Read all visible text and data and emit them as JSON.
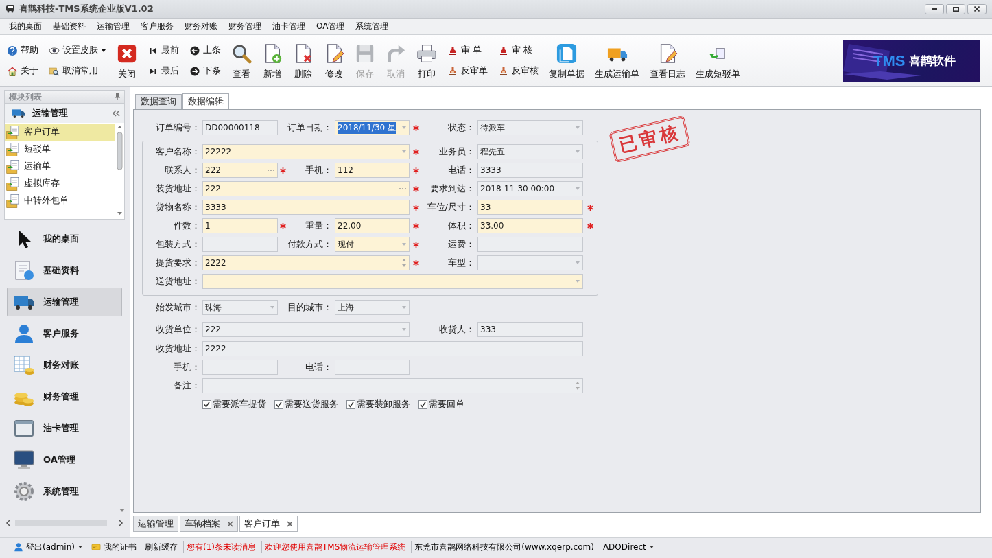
{
  "window": {
    "title": "喜鹊科技-TMS系统企业版V1.02"
  },
  "menu": [
    "我的桌面",
    "基础资料",
    "运输管理",
    "客户服务",
    "财务对账",
    "财务管理",
    "油卡管理",
    "OA管理",
    "系统管理"
  ],
  "toolbar": [
    {
      "kind": "stack",
      "buttons": [
        {
          "label": "帮助",
          "dropdown": false,
          "disabled": false
        },
        {
          "label": "关于",
          "dropdown": false,
          "disabled": false
        }
      ]
    },
    {
      "kind": "stack",
      "buttons": [
        {
          "label": "设置皮肤",
          "dropdown": true,
          "disabled": false
        },
        {
          "label": "取消常用",
          "dropdown": false,
          "disabled": false
        }
      ]
    },
    {
      "kind": "large",
      "label": "关闭",
      "disabled": false
    },
    {
      "kind": "stack",
      "buttons": [
        {
          "label": "最前",
          "dropdown": false,
          "disabled": false
        },
        {
          "label": "最后",
          "dropdown": false,
          "disabled": false
        }
      ]
    },
    {
      "kind": "stack",
      "buttons": [
        {
          "label": "上条",
          "dropdown": false,
          "disabled": false
        },
        {
          "label": "下条",
          "dropdown": false,
          "disabled": false
        }
      ]
    },
    {
      "kind": "large",
      "label": "查看",
      "disabled": false
    },
    {
      "kind": "large",
      "label": "新增",
      "disabled": false
    },
    {
      "kind": "large",
      "label": "删除",
      "disabled": false
    },
    {
      "kind": "large",
      "label": "修改",
      "disabled": false
    },
    {
      "kind": "large",
      "label": "保存",
      "disabled": true
    },
    {
      "kind": "large",
      "label": "取消",
      "disabled": true
    },
    {
      "kind": "large",
      "label": "打印",
      "disabled": false
    },
    {
      "kind": "stack",
      "buttons": [
        {
          "label": "审 单",
          "dropdown": false,
          "disabled": false
        },
        {
          "label": "反审单",
          "dropdown": false,
          "disabled": false
        }
      ]
    },
    {
      "kind": "stack",
      "buttons": [
        {
          "label": "审 核",
          "dropdown": false,
          "disabled": false
        },
        {
          "label": "反审核",
          "dropdown": false,
          "disabled": false
        }
      ]
    },
    {
      "kind": "large",
      "label": "复制单据",
      "disabled": false
    },
    {
      "kind": "large",
      "label": "生成运输单",
      "disabled": false
    },
    {
      "kind": "large",
      "label": "查看日志",
      "disabled": false
    },
    {
      "kind": "large",
      "label": "生成短驳单",
      "disabled": false
    }
  ],
  "logo": {
    "title": "TMS",
    "subtitle": "喜鹊软件"
  },
  "sidebar": {
    "title": "模块列表",
    "group": "运输管理",
    "items": [
      {
        "label": "客户订单",
        "selected": true
      },
      {
        "label": "短驳单",
        "selected": false
      },
      {
        "label": "运输单",
        "selected": false
      },
      {
        "label": "虚拟库存",
        "selected": false
      },
      {
        "label": "中转外包单",
        "selected": false
      }
    ],
    "nav": [
      {
        "label": "我的桌面",
        "selected": false
      },
      {
        "label": "基础资料",
        "selected": false
      },
      {
        "label": "运输管理",
        "selected": true
      },
      {
        "label": "客户服务",
        "selected": false
      },
      {
        "label": "财务对账",
        "selected": false
      },
      {
        "label": "财务管理",
        "selected": false
      },
      {
        "label": "油卡管理",
        "selected": false
      },
      {
        "label": "OA管理",
        "selected": false
      },
      {
        "label": "系统管理",
        "selected": false
      }
    ]
  },
  "form_tabs": [
    {
      "label": "数据查询",
      "selected": false
    },
    {
      "label": "数据编辑",
      "selected": true
    }
  ],
  "form": {
    "top_rows": [
      {
        "fields": [
          {
            "label": "订单编号：",
            "value": "DD00000118",
            "kind": "text",
            "required": false,
            "highlighted": false,
            "text_selected": false
          },
          {
            "label": "订单日期：",
            "value": "2018/11/30 星",
            "kind": "date",
            "required": true,
            "highlighted": true,
            "text_selected": true
          },
          {
            "label": "状态：",
            "value": "待派车",
            "kind": "combo",
            "required": false,
            "highlighted": false,
            "text_selected": false
          }
        ]
      }
    ],
    "group_rows": [
      {
        "fields": [
          {
            "label": "客户名称：",
            "value": "22222",
            "kind": "combo",
            "required": true,
            "highlighted": true,
            "text_selected": false
          },
          {
            "label": "业务员：",
            "value": "程先五",
            "kind": "combo",
            "required": false,
            "highlighted": false,
            "text_selected": false
          }
        ]
      },
      {
        "fields": [
          {
            "label": "联系人：",
            "value": "222",
            "kind": "lookup",
            "required": true,
            "highlighted": true,
            "text_selected": false
          },
          {
            "label": "手机：",
            "value": "112",
            "kind": "text",
            "required": true,
            "highlighted": true,
            "text_selected": false
          },
          {
            "label": "电话：",
            "value": "3333",
            "kind": "text",
            "required": false,
            "highlighted": false,
            "text_selected": false
          }
        ]
      },
      {
        "fields": [
          {
            "label": "装货地址：",
            "value": "222",
            "kind": "lookup",
            "required": true,
            "highlighted": true,
            "text_selected": false
          },
          {
            "label": "要求到达：",
            "value": "2018-11-30 00:00",
            "kind": "combo",
            "required": false,
            "highlighted": false,
            "text_selected": false
          }
        ]
      },
      {
        "fields": [
          {
            "label": "货物名称：",
            "value": "3333",
            "kind": "text",
            "required": true,
            "highlighted": true,
            "text_selected": false
          },
          {
            "label": "车位/尺寸：",
            "value": "33",
            "kind": "text",
            "required": true,
            "highlighted": true,
            "text_selected": false
          }
        ]
      },
      {
        "fields": [
          {
            "label": "件数：",
            "value": "1",
            "kind": "text",
            "required": true,
            "highlighted": true,
            "text_selected": false
          },
          {
            "label": "重量：",
            "value": "22.00",
            "kind": "text",
            "required": true,
            "highlighted": true,
            "text_selected": false
          },
          {
            "label": "体积：",
            "value": "33.00",
            "kind": "text",
            "required": true,
            "highlighted": true,
            "text_selected": false
          }
        ]
      },
      {
        "fields": [
          {
            "label": "包装方式：",
            "kind": "text",
            "required": false,
            "highlighted": false
          },
          {
            "label": "付款方式：",
            "value": "现付",
            "kind": "combo",
            "required": true,
            "highlighted": true,
            "text_selected": false
          },
          {
            "label": "运费：",
            "kind": "text",
            "required": false,
            "highlighted": false
          }
        ]
      },
      {
        "fields": [
          {
            "label": "提货要求：",
            "value": "2222",
            "kind": "memo",
            "required": true,
            "highlighted": true,
            "text_selected": false
          },
          {
            "label": "车型：",
            "kind": "combo",
            "required": false,
            "highlighted": false
          }
        ]
      },
      {
        "fields": [
          {
            "label": "送货地址：",
            "kind": "combo",
            "required": false,
            "highlighted": true
          }
        ]
      }
    ],
    "rows": [
      {
        "fields": [
          {
            "label": "始发城市：",
            "value": "珠海",
            "kind": "combo",
            "required": false,
            "highlighted": false,
            "text_selected": false
          },
          {
            "label": "目的城市：",
            "value": "上海",
            "kind": "combo",
            "required": false,
            "highlighted": false,
            "text_selected": false
          }
        ]
      },
      {
        "fields": [
          {
            "label": "收货单位：",
            "value": "222",
            "kind": "combo",
            "required": false,
            "highlighted": false,
            "text_selected": false
          },
          {
            "label": "收货人：",
            "value": "333",
            "kind": "text",
            "required": false,
            "highlighted": false,
            "text_selected": false
          }
        ]
      },
      {
        "fields": [
          {
            "label": "收货地址：",
            "value": "2222",
            "kind": "text",
            "required": false,
            "highlighted": false,
            "text_selected": false
          }
        ]
      },
      {
        "fields": [
          {
            "label": "手机：",
            "kind": "text",
            "required": false,
            "highlighted": false
          },
          {
            "label": "电话：",
            "kind": "text",
            "required": false,
            "highlighted": false
          }
        ]
      },
      {
        "fields": [
          {
            "label": "备注：",
            "kind": "memo",
            "required": false,
            "highlighted": false
          }
        ]
      }
    ],
    "checkboxes": [
      {
        "label": "需要派车提货",
        "checked": true
      },
      {
        "label": "需要送货服务",
        "checked": true
      },
      {
        "label": "需要装卸服务",
        "checked": true
      },
      {
        "label": "需要回单",
        "checked": true
      }
    ],
    "stamp": "已审核"
  },
  "doc_tabs": [
    {
      "label": "运输管理",
      "selected": false,
      "closable": false
    },
    {
      "label": "车辆档案",
      "selected": false,
      "closable": true
    },
    {
      "label": "客户订单",
      "selected": true,
      "closable": true
    }
  ],
  "status_bar": [
    {
      "text": "登出(admin)",
      "dropdown": true,
      "alert": false
    },
    {
      "text": "我的证书",
      "dropdown": false,
      "alert": false
    },
    {
      "text": "刷新缓存",
      "dropdown": false,
      "alert": false
    },
    {
      "text": "您有(1)条未读消息",
      "dropdown": false,
      "alert": true
    },
    {
      "text": "欢迎您使用喜鹊TMS物流运输管理系统",
      "dropdown": false,
      "alert": true
    },
    {
      "text": "东莞市喜鹊网络科技有限公司(www.xqerp.com)",
      "dropdown": false,
      "alert": false
    },
    {
      "text": "ADODirect",
      "dropdown": true,
      "alert": false
    }
  ]
}
